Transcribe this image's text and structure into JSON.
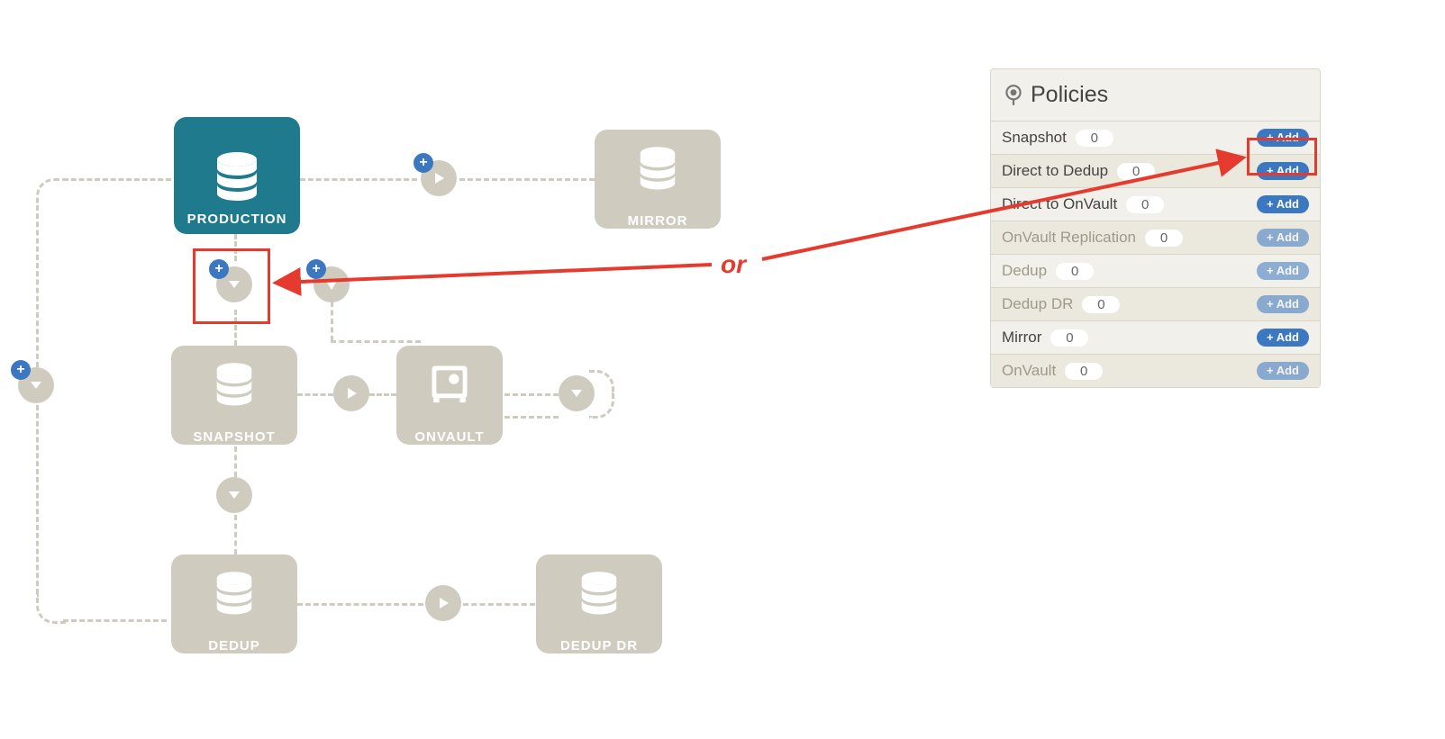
{
  "annotation": {
    "or_label": "or"
  },
  "diagram": {
    "nodes": {
      "production": {
        "label": "PRODUCTION"
      },
      "mirror": {
        "label": "MIRROR"
      },
      "snapshot": {
        "label": "SNAPSHOT"
      },
      "onvault": {
        "label": "ONVAULT"
      },
      "dedup": {
        "label": "DEDUP"
      },
      "dedup_dr": {
        "label": "DEDUP DR"
      }
    }
  },
  "policies": {
    "title": "Policies",
    "rows": [
      {
        "label": "Snapshot",
        "count": "0",
        "enabled": true,
        "add_label": "+ Add"
      },
      {
        "label": "Direct to Dedup",
        "count": "0",
        "enabled": true,
        "add_label": "+ Add"
      },
      {
        "label": "Direct to OnVault",
        "count": "0",
        "enabled": true,
        "add_label": "+ Add"
      },
      {
        "label": "OnVault Replication",
        "count": "0",
        "enabled": false,
        "add_label": "+ Add"
      },
      {
        "label": "Dedup",
        "count": "0",
        "enabled": false,
        "add_label": "+ Add"
      },
      {
        "label": "Dedup DR",
        "count": "0",
        "enabled": false,
        "add_label": "+ Add"
      },
      {
        "label": "Mirror",
        "count": "0",
        "enabled": true,
        "add_label": "+ Add"
      },
      {
        "label": "OnVault",
        "count": "0",
        "enabled": false,
        "add_label": "+ Add"
      }
    ]
  }
}
